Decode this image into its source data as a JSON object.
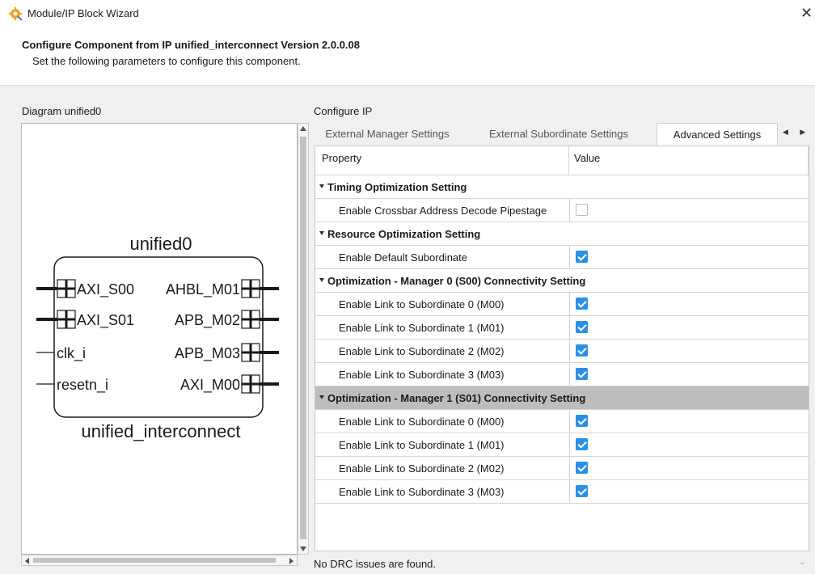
{
  "window": {
    "title": "Module/IP Block Wizard",
    "close_glyph": "✕"
  },
  "header": {
    "title": "Configure Component from IP unified_interconnect Version 2.0.0.08",
    "subtitle": "Set the following parameters to configure this component."
  },
  "diagram": {
    "label": "Diagram unified0",
    "instance_name": "unified0",
    "module_name": "unified_interconnect",
    "left_ports": [
      {
        "name": "AXI_S00",
        "bus": true
      },
      {
        "name": "AXI_S01",
        "bus": true
      },
      {
        "name": "clk_i",
        "bus": false
      },
      {
        "name": "resetn_i",
        "bus": false
      }
    ],
    "right_ports": [
      {
        "name": "AHBL_M01",
        "bus": true
      },
      {
        "name": "APB_M02",
        "bus": true
      },
      {
        "name": "APB_M03",
        "bus": true
      },
      {
        "name": "AXI_M00",
        "bus": true
      }
    ]
  },
  "configure": {
    "label": "Configure IP",
    "tabs": [
      {
        "label": "External Manager Settings",
        "active": false
      },
      {
        "label": "External Subordinate Settings",
        "active": false
      },
      {
        "label": "Advanced Settings",
        "active": true
      }
    ],
    "tab_arrows": "◀ ▶",
    "columns": {
      "property": "Property",
      "value": "Value"
    },
    "rows": [
      {
        "type": "group",
        "label": "Timing Optimization Setting"
      },
      {
        "type": "prop",
        "label": "Enable Crossbar Address Decode Pipestage",
        "checked": false
      },
      {
        "type": "group",
        "label": "Resource Optimization Setting"
      },
      {
        "type": "prop",
        "label": "Enable Default Subordinate",
        "checked": true
      },
      {
        "type": "group",
        "label": "Optimization - Manager 0 (S00) Connectivity Setting"
      },
      {
        "type": "prop",
        "label": "Enable Link to Subordinate 0 (M00)",
        "checked": true
      },
      {
        "type": "prop",
        "label": "Enable Link to Subordinate 1 (M01)",
        "checked": true
      },
      {
        "type": "prop",
        "label": "Enable Link to Subordinate 2 (M02)",
        "checked": true
      },
      {
        "type": "prop",
        "label": "Enable Link to Subordinate 3 (M03)",
        "checked": true
      },
      {
        "type": "group",
        "label": "Optimization - Manager 1 (S01) Connectivity Setting",
        "selected": true
      },
      {
        "type": "prop",
        "label": "Enable Link to Subordinate 0 (M00)",
        "checked": true
      },
      {
        "type": "prop",
        "label": "Enable Link to Subordinate 1 (M01)",
        "checked": true
      },
      {
        "type": "prop",
        "label": "Enable Link to Subordinate 2 (M02)",
        "checked": true
      },
      {
        "type": "prop",
        "label": "Enable Link to Subordinate 3 (M03)",
        "checked": true
      }
    ]
  },
  "status": {
    "message": "No DRC issues are found.",
    "caret": "⌄"
  },
  "colors": {
    "accent_checkbox": "#2b8fe8",
    "selected_row": "#bdbdbd"
  },
  "icons": [
    "wizard-app-icon",
    "close-icon",
    "collapse-triangle-icon",
    "checkbox-icon",
    "bus-port-icon",
    "tab-scroll-arrows-icon"
  ]
}
